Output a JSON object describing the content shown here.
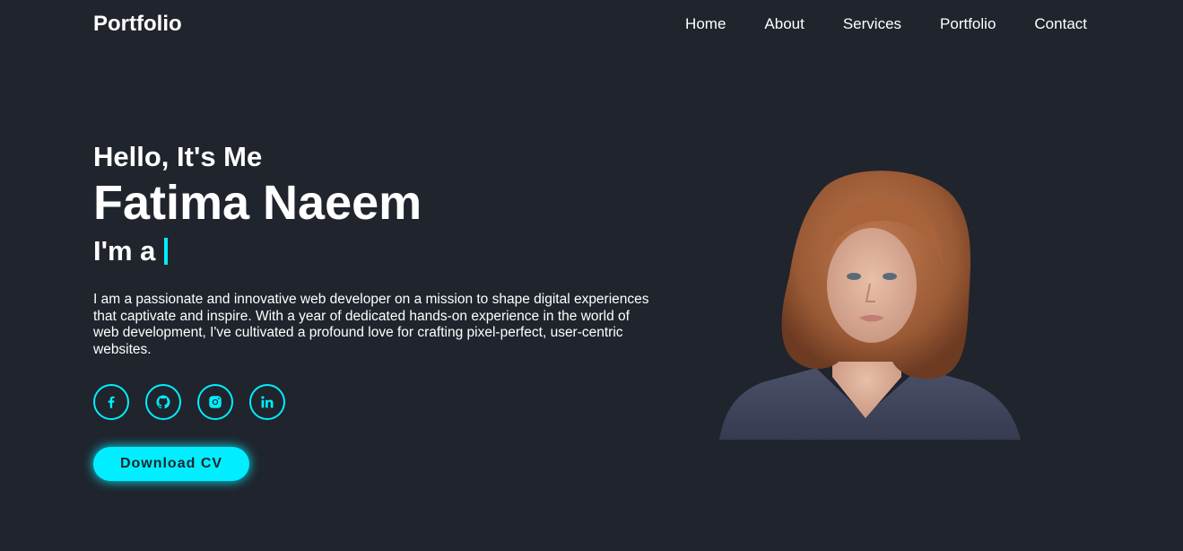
{
  "header": {
    "logo": "Portfolio",
    "nav": [
      "Home",
      "About",
      "Services",
      "Portfolio",
      "Contact"
    ]
  },
  "hero": {
    "greeting": "Hello, It's Me",
    "name": "Fatima Naeem",
    "role_prefix": "I'm a",
    "bio": "I am a passionate and innovative web developer on a mission to shape digital experiences that captivate and inspire. With a year of dedicated hands-on experience in the world of web development, I've cultivated a profound love for crafting pixel-perfect, user-centric websites.",
    "socials": [
      "facebook-icon",
      "github-icon",
      "instagram-icon",
      "linkedin-icon"
    ],
    "cta_label": "Download CV"
  },
  "colors": {
    "background": "#1f242d",
    "accent": "#00eeff",
    "text": "#ffffff"
  }
}
